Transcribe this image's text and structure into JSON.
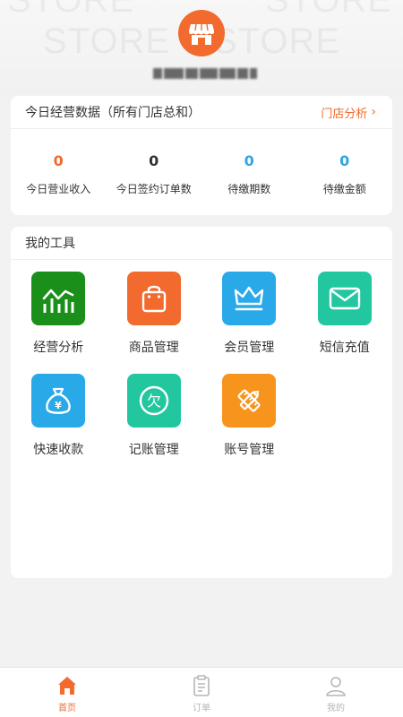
{
  "header": {
    "watermark": "STORE",
    "store_name": "███████"
  },
  "stats_card": {
    "title": "今日经营数据（所有门店总和）",
    "link_label": "门店分析",
    "items": [
      {
        "value": "0",
        "label": "今日营业收入",
        "color": "#f26a2e"
      },
      {
        "value": "0",
        "label": "今日签约订单数",
        "color": "#333333"
      },
      {
        "value": "0",
        "label": "待缴期数",
        "color": "#2ea7e0"
      },
      {
        "value": "0",
        "label": "待缴金额",
        "color": "#2ea7e0"
      }
    ]
  },
  "tools_card": {
    "title": "我的工具",
    "items": [
      {
        "label": "经营分析",
        "icon": "chart-icon",
        "color": "#1a8f1a"
      },
      {
        "label": "商品管理",
        "icon": "shopping-bag-icon",
        "color": "#f26a2e"
      },
      {
        "label": "会员管理",
        "icon": "crown-icon",
        "color": "#2aa9e8"
      },
      {
        "label": "短信充值",
        "icon": "envelope-icon",
        "color": "#22c7a0"
      },
      {
        "label": "快速收款",
        "icon": "money-bag-icon",
        "color": "#2aa9e8"
      },
      {
        "label": "记账管理",
        "icon": "debt-icon",
        "color": "#22c7a0"
      },
      {
        "label": "账号管理",
        "icon": "ruler-icon",
        "color": "#f7941d"
      }
    ]
  },
  "tabbar": {
    "items": [
      {
        "label": "首页",
        "icon": "home-icon",
        "active": true
      },
      {
        "label": "订单",
        "icon": "clipboard-icon",
        "active": false
      },
      {
        "label": "我的",
        "icon": "user-icon",
        "active": false
      }
    ],
    "active_color": "#f26a2e",
    "inactive_color": "#b5b5b5"
  }
}
